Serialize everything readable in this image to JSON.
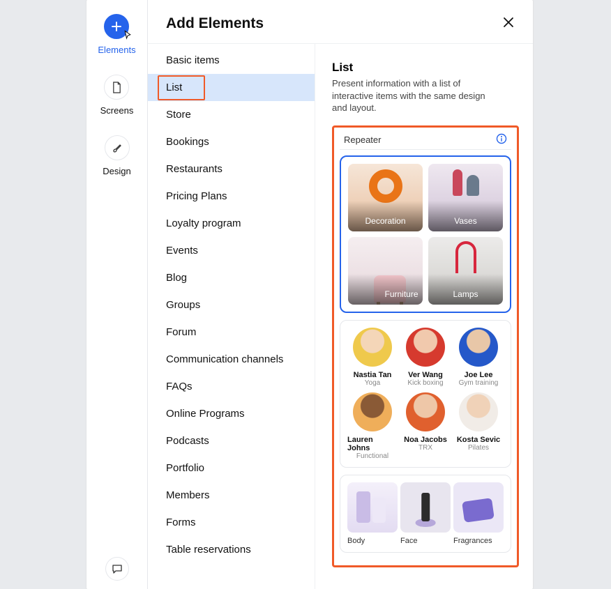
{
  "header": {
    "title": "Add Elements"
  },
  "rail": {
    "items": [
      {
        "label": "Elements",
        "active": true
      },
      {
        "label": "Screens",
        "active": false
      },
      {
        "label": "Design",
        "active": false
      }
    ]
  },
  "categories": {
    "selected_index": 1,
    "items": [
      "Basic items",
      "List",
      "Store",
      "Bookings",
      "Restaurants",
      "Pricing Plans",
      "Loyalty program",
      "Events",
      "Blog",
      "Groups",
      "Forum",
      "Communication channels",
      "FAQs",
      "Online Programs",
      "Podcasts",
      "Portfolio",
      "Members",
      "Forms",
      "Table reservations"
    ]
  },
  "detail": {
    "title": "List",
    "description": "Present information with a list of interactive items with the same design and layout.",
    "section_label": "Repeater",
    "template1": {
      "tiles": [
        "Decoration",
        "Vases",
        "Furniture",
        "Lamps"
      ]
    },
    "template2": {
      "people": [
        {
          "name": "Nastia Tan",
          "role": "Yoga"
        },
        {
          "name": "Ver Wang",
          "role": "Kick boxing"
        },
        {
          "name": "Joe Lee",
          "role": "Gym training"
        },
        {
          "name": "Lauren Johns",
          "role": "Functional"
        },
        {
          "name": "Noa Jacobs",
          "role": "TRX"
        },
        {
          "name": "Kosta Sevic",
          "role": "Pilates"
        }
      ]
    },
    "template3": {
      "products": [
        "Body",
        "Face",
        "Fragrances"
      ]
    }
  }
}
